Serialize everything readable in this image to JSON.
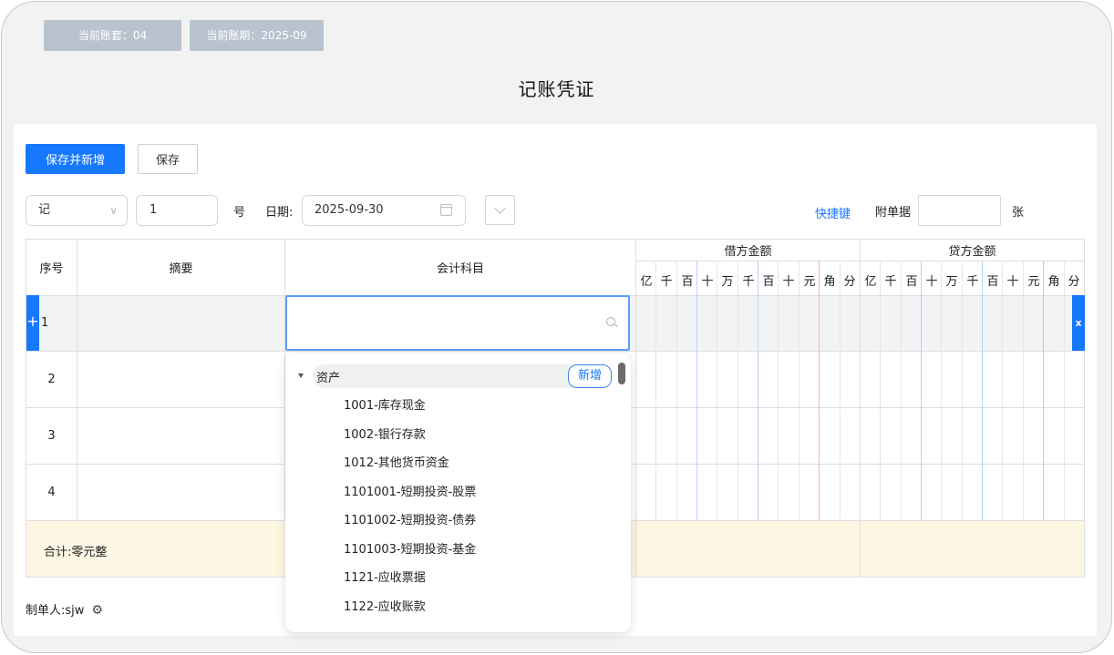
{
  "header": {
    "account_set": "当前账套：04",
    "period": "当前账期：2025-09",
    "title": "记账凭证"
  },
  "toolbar": {
    "save_new_label": "保存并新增",
    "save_label": "保存"
  },
  "form": {
    "voucher_type": "记",
    "voucher_number": "1",
    "number_suffix": "号",
    "date_label": "日期:",
    "date_value": "2025-09-30",
    "shortcut_label": "快捷键",
    "attachments_label": "附单据",
    "attachments_value": "",
    "attachments_unit": "张"
  },
  "table": {
    "headers": {
      "seq": "序号",
      "summary": "摘要",
      "subject": "会计科目",
      "debit": "借方金额",
      "credit": "贷方金额"
    },
    "digit_units": [
      "亿",
      "千",
      "百",
      "十",
      "万",
      "千",
      "百",
      "十",
      "元",
      "角",
      "分"
    ],
    "rows": [
      {
        "seq": "1"
      },
      {
        "seq": "2"
      },
      {
        "seq": "3"
      },
      {
        "seq": "4"
      }
    ],
    "add_row_symbol": "+",
    "delete_row_symbol": "x",
    "total_label": "合计:零元整"
  },
  "footer": {
    "maker_label": "制单人:sjw",
    "settings_icon": "gear-icon"
  },
  "subject_dropdown": {
    "group_label": "资产",
    "add_label": "新增",
    "items": [
      "1001-库存现金",
      "1002-银行存款",
      "1012-其他货币资金",
      "1101001-短期投资-股票",
      "1101002-短期投资-债券",
      "1101003-短期投资-基金",
      "1121-应收票据",
      "1122-应收账款"
    ]
  },
  "colors": {
    "primary": "#1677ff",
    "tag_bg": "#b9c3cf",
    "total_bg": "#fdf6e3",
    "active_row_bg": "#f2f3f5"
  }
}
